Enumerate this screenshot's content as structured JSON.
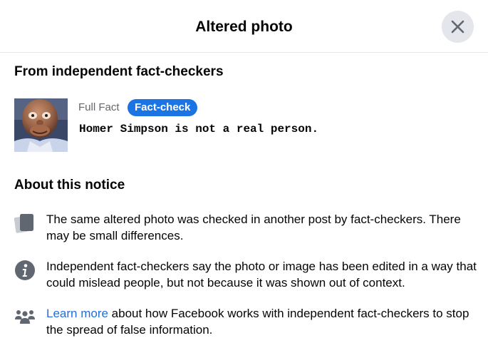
{
  "dialog": {
    "title": "Altered photo",
    "close_icon": "close-icon"
  },
  "fact_check": {
    "heading": "From independent fact-checkers",
    "source": "Full Fact",
    "badge": "Fact-check",
    "claim": "Homer Simpson is not a real person.",
    "badge_color": "#1b74e4"
  },
  "about": {
    "heading": "About this notice",
    "items": [
      {
        "icon": "duplicate-photos-icon",
        "text": "The same altered photo was checked in another post by fact-checkers. There may be small differences."
      },
      {
        "icon": "info-icon",
        "text": "Independent fact-checkers say the photo or image has been edited in a way that could mislead people, but not because it was shown out of context."
      },
      {
        "icon": "people-group-icon",
        "link_text": "Learn more",
        "text": " about how Facebook works with independent fact-checkers to stop the spread of false information."
      }
    ]
  },
  "colors": {
    "link": "#216fdb",
    "divider": "#e4e6eb",
    "secondary_text": "#65676b",
    "icon": "#606770"
  }
}
